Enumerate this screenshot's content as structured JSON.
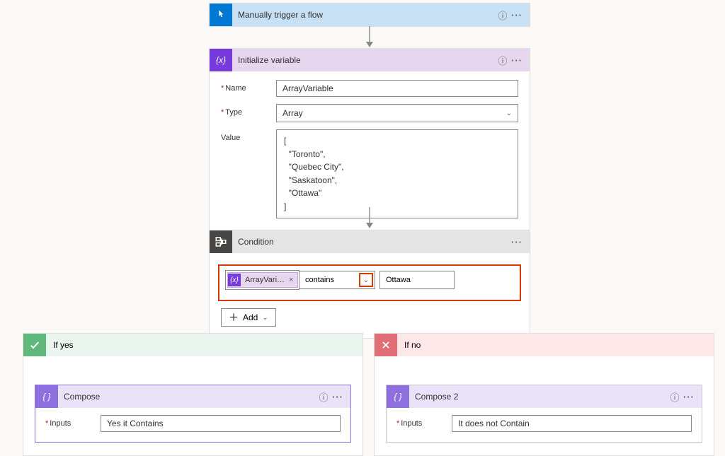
{
  "trigger": {
    "title": "Manually trigger a flow"
  },
  "initvar": {
    "title": "Initialize variable",
    "name_label": "Name",
    "type_label": "Type",
    "value_label": "Value",
    "name_value": "ArrayVariable",
    "type_value": "Array",
    "value_value": "[\n  \"Toronto\",\n  \"Quebec City\",\n  \"Saskatoon\",\n  \"Ottawa\"\n]"
  },
  "condition": {
    "title": "Condition",
    "token_label": "ArrayVari…",
    "operator": "contains",
    "rhs_value": "Ottawa",
    "add_label": "Add"
  },
  "branches": {
    "yes_label": "If yes",
    "no_label": "If no"
  },
  "compose_yes": {
    "title": "Compose",
    "inputs_label": "Inputs",
    "inputs_value": "Yes it Contains"
  },
  "compose_no": {
    "title": "Compose 2",
    "inputs_label": "Inputs",
    "inputs_value": "It does not Contain"
  }
}
